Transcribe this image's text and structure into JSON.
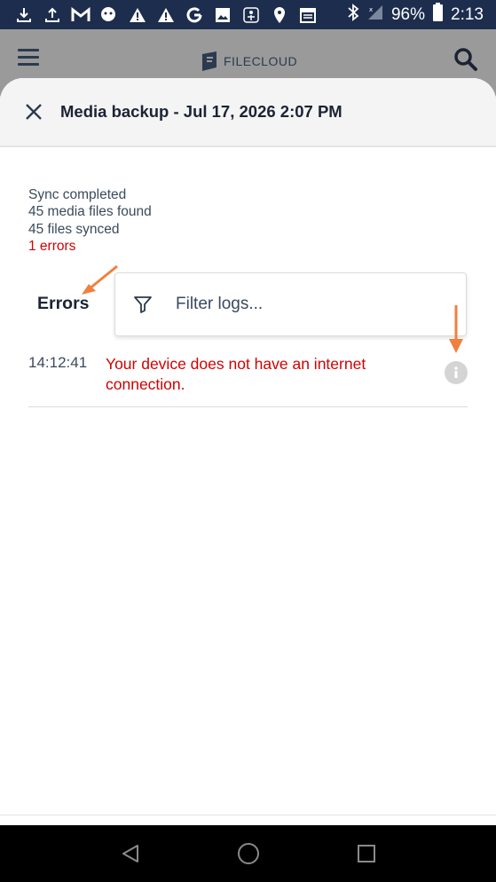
{
  "status_bar": {
    "battery": "96%",
    "time": "2:13",
    "icons": [
      "download-icon",
      "upload-icon",
      "gmail-icon",
      "chat-icon",
      "warning-icon",
      "warning-icon",
      "google-icon",
      "image-icon",
      "accessibility-icon",
      "location-icon",
      "calendar-icon",
      "bluetooth-icon",
      "signal-icon",
      "battery-icon"
    ]
  },
  "app": {
    "logo_text": "FILECLOUD"
  },
  "sheet": {
    "title": "Media backup - Jul 17, 2026 2:07 PM",
    "summary": {
      "line1": "Sync completed",
      "line2": "45 media files found",
      "line3": "45 files synced",
      "errors": "1 errors"
    },
    "errors_label": "Errors",
    "filter": {
      "placeholder": "Filter logs..."
    },
    "logs": [
      {
        "time": "14:12:41",
        "message": "Your device does not have an internet connection."
      }
    ]
  },
  "colors": {
    "error": "#d10000",
    "annotation_arrow": "#f08040",
    "status_bar": "#1d2d4d"
  }
}
